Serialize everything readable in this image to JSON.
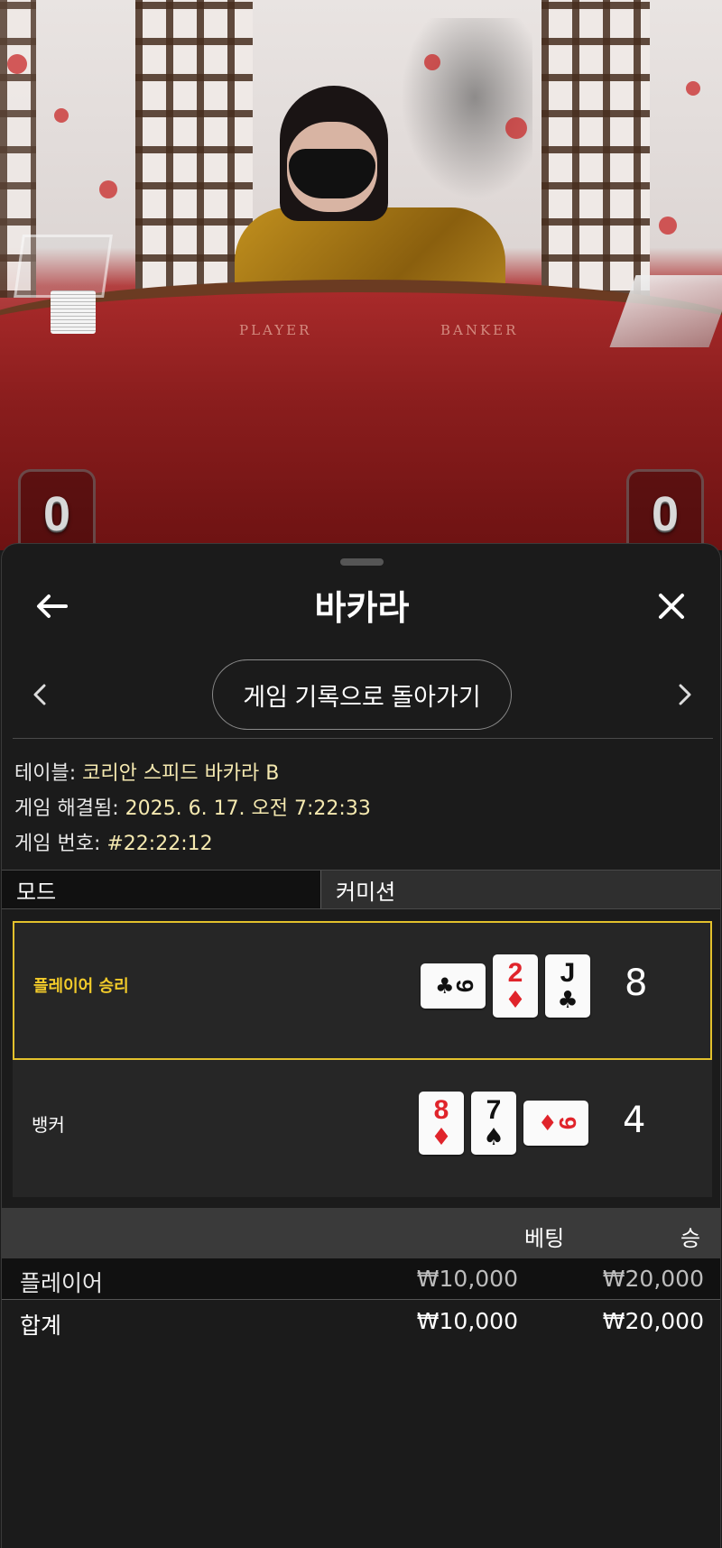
{
  "video": {
    "table_labels": [
      "PLAYER",
      "BANKER"
    ],
    "player_score": "0",
    "banker_score": "0"
  },
  "sheet": {
    "title": "바카라",
    "back_icon": "arrow-left-icon",
    "close_icon": "close-icon",
    "history_button": "게임 기록으로 돌아가기",
    "info": {
      "table_label": "테이블: ",
      "table_value": "코리안 스피드 바카라 B",
      "resolved_label": "게임 해결됨: ",
      "resolved_value": "2025. 6. 17. 오전 7:22:33",
      "game_no_label": "게임 번호: ",
      "game_no_value": "#22:22:12"
    },
    "mode": {
      "label": "모드",
      "value": "커미션"
    },
    "hands": {
      "player": {
        "label": "플레이어 승리",
        "total": "8",
        "winner": true,
        "cards": [
          {
            "rank": "9",
            "suit": "♣",
            "color": "black",
            "sideways": true
          },
          {
            "rank": "2",
            "suit": "♦",
            "color": "red",
            "sideways": false
          },
          {
            "rank": "J",
            "suit": "♣",
            "color": "black",
            "sideways": false
          }
        ]
      },
      "banker": {
        "label": "뱅커",
        "total": "4",
        "winner": false,
        "cards": [
          {
            "rank": "8",
            "suit": "♦",
            "color": "red",
            "sideways": false
          },
          {
            "rank": "7",
            "suit": "♠",
            "color": "black",
            "sideways": false
          },
          {
            "rank": "9",
            "suit": "♦",
            "color": "red",
            "sideways": true
          }
        ]
      }
    },
    "bets": {
      "columns": {
        "bet": "베팅",
        "win": "승"
      },
      "rows": [
        {
          "name": "플레이어",
          "bet": "₩10,000",
          "win": "₩20,000"
        }
      ],
      "total": {
        "name": "합계",
        "bet": "₩10,000",
        "win": "₩20,000"
      }
    }
  },
  "colors": {
    "winner_border": "#e3c12c",
    "winner_label": "#f2cb2a",
    "info_value": "#f5e9b0",
    "card_red": "#e0242b"
  }
}
